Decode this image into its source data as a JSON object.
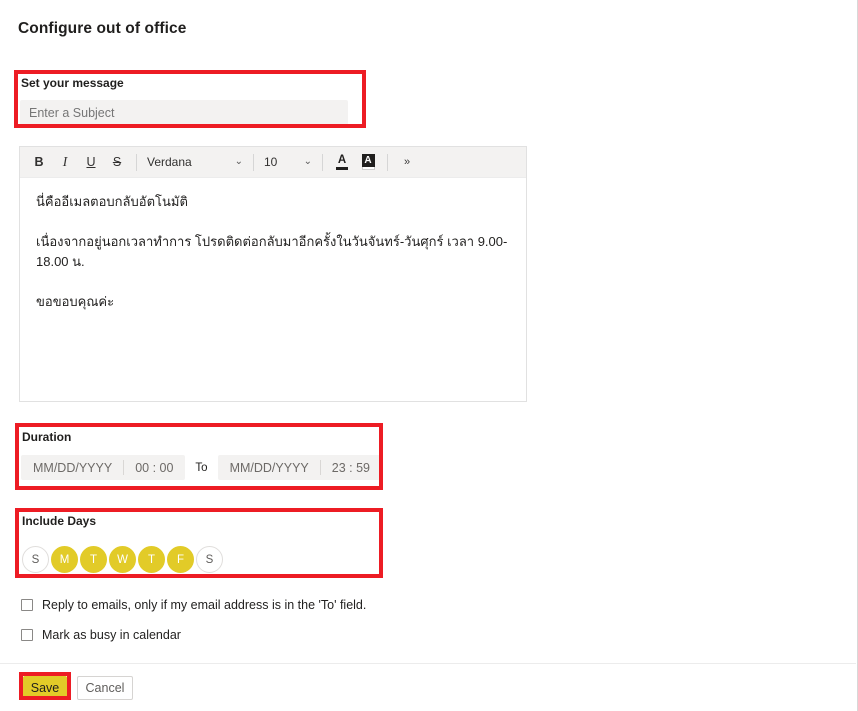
{
  "page": {
    "title": "Configure out of office"
  },
  "message_section": {
    "label": "Set your message",
    "subject": {
      "value": "",
      "placeholder": "Enter a Subject"
    }
  },
  "editor": {
    "toolbar": {
      "bold": "B",
      "italic": "I",
      "underline": "U",
      "strikethrough": "S",
      "font_family": "Verdana",
      "font_size": "10",
      "caret": "⌄",
      "font_color_letter": "A",
      "highlight_letter": "A",
      "more_options": "»"
    },
    "body": {
      "paragraph1": "นี่คืออีเมลตอบกลับอัตโนมัติ",
      "paragraph2": "เนื่องจากอยู่นอกเวลาทำการ โปรดติดต่อกลับมาอีกครั้งในวันจันทร์-วันศุกร์ เวลา 9.00-18.00 น.",
      "paragraph3": "ขอขอบคุณค่ะ"
    }
  },
  "duration_section": {
    "label": "Duration",
    "start": {
      "date_placeholder": "MM/DD/YYYY",
      "time_value": "00 : 00"
    },
    "to_label": "To",
    "end": {
      "date_placeholder": "MM/DD/YYYY",
      "time_value": "23 : 59"
    }
  },
  "include_days_section": {
    "label": "Include Days",
    "days": [
      {
        "letter": "S",
        "name": "sunday",
        "selected": false
      },
      {
        "letter": "M",
        "name": "monday",
        "selected": true
      },
      {
        "letter": "T",
        "name": "tuesday",
        "selected": true
      },
      {
        "letter": "W",
        "name": "wednesday",
        "selected": true
      },
      {
        "letter": "T",
        "name": "thursday",
        "selected": true
      },
      {
        "letter": "F",
        "name": "friday",
        "selected": true
      },
      {
        "letter": "S",
        "name": "saturday",
        "selected": false
      }
    ]
  },
  "options": {
    "reply_to_label": "Reply to emails, only if my email address is in the 'To' field.",
    "reply_to_checked": false,
    "mark_busy_label": "Mark as busy in calendar",
    "mark_busy_checked": false
  },
  "footer": {
    "save_label": "Save",
    "cancel_label": "Cancel"
  },
  "colors": {
    "accent_gold": "#E2CB28",
    "annotation_red": "#ED1C24",
    "input_background": "#f3f2f1"
  }
}
